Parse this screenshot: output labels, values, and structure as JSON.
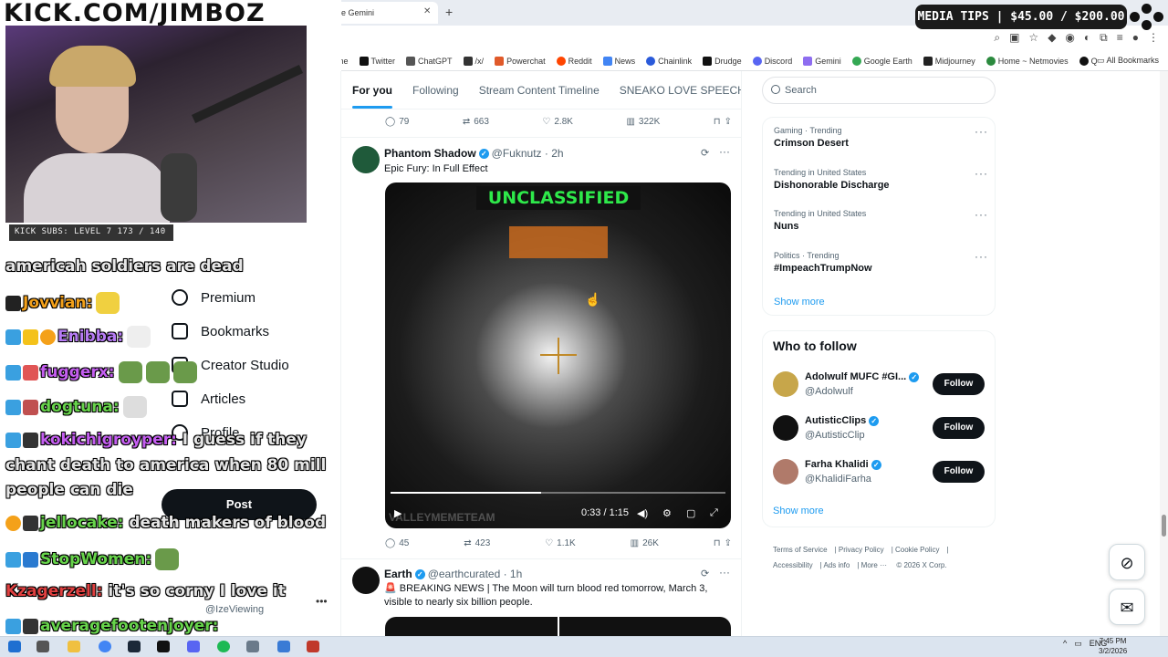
{
  "stream_overlay": {
    "banner": "KICK.COM/JIMBOZ",
    "subs_bar": "KICK SUBS: LEVEL 7 173 / 140",
    "media_tips": "MEDIA TIPS | $45.00 / $200.00",
    "chat": [
      {
        "user": "",
        "text": "americah soldiers are dead",
        "user_color": "#ffffff"
      },
      {
        "user": "Jovvian:",
        "text": "",
        "user_color": "#f4a11a"
      },
      {
        "user": "Enibba:",
        "text": "",
        "user_color": "#b77cf5"
      },
      {
        "user": "fuggerx:",
        "text": "",
        "user_color": "#c45ef0"
      },
      {
        "user": "dogtuna:",
        "text": "",
        "user_color": "#67d44b"
      },
      {
        "user": "kokichigroyper:",
        "text": "I guess if they",
        "user_color": "#c45ef0"
      },
      {
        "user": "",
        "text": "chant death to america when 80 mill",
        "user_color": "#ffffff"
      },
      {
        "user": "",
        "text": "people can die",
        "user_color": "#ffffff"
      },
      {
        "user": "jellocake:",
        "text": "death makers of blood",
        "user_color": "#67d44b"
      },
      {
        "user": "StopWomen:",
        "text": "",
        "user_color": "#67d44b"
      },
      {
        "user": "Kzagerzell:",
        "text": "it's so corny I love it",
        "user_color": "#e04040"
      },
      {
        "user": "averagefootenjoyer:",
        "text": "",
        "user_color": "#67d44b"
      }
    ]
  },
  "browser": {
    "tab_title": "Google Gemini",
    "bookmarks": [
      "Gioryp.me",
      "Twitter",
      "ChatGPT",
      "/x/",
      "Powerchat",
      "Reddit",
      "News",
      "Chainlink",
      "Drudge",
      "Discord",
      "Gemini",
      "Google Earth",
      "Midjourney",
      "Home ~ Netmovies",
      "Q"
    ],
    "all_bookmarks": "All Bookmarks"
  },
  "sidebar": {
    "items": [
      {
        "label": "Premium",
        "icon": "verified-icon"
      },
      {
        "label": "Bookmarks",
        "icon": "bookmark-icon"
      },
      {
        "label": "Creator Studio",
        "icon": "creator-studio-icon"
      },
      {
        "label": "Articles",
        "icon": "article-icon"
      },
      {
        "label": "Profile",
        "icon": "profile-icon"
      }
    ],
    "post_button": "Post",
    "account_handle": "@IzeViewing"
  },
  "feed": {
    "tabs": [
      "For you",
      "Following",
      "Stream Content Timeline",
      "SNEAKO LOVE SPEECH"
    ],
    "prev_actions": {
      "replies": "79",
      "reposts": "663",
      "likes": "2.8K",
      "views": "322K"
    },
    "tweet1": {
      "name": "Phantom Shadow",
      "handle": "@Fuknutz",
      "time": "· 2h",
      "text": "Epic Fury: In Full Effect",
      "video_label": "UNCLASSIFIED",
      "video_time": "0:33 / 1:15",
      "video_progress": 0.45,
      "watermark": "VALLEYMEMETEAM",
      "actions": {
        "replies": "45",
        "reposts": "423",
        "likes": "1.1K",
        "views": "26K"
      }
    },
    "tweet2": {
      "name": "Earth",
      "handle": "@earthcurated",
      "time": "· 1h",
      "text": "🚨 BREAKING NEWS | The Moon will turn blood red tomorrow, March 3, visible to nearly six billion people."
    }
  },
  "right": {
    "search_placeholder": "Search",
    "trends": [
      {
        "category": "Gaming · Trending",
        "name": "Crimson Desert"
      },
      {
        "category": "Trending in United States",
        "name": "Dishonorable Discharge"
      },
      {
        "category": "Trending in United States",
        "name": "Nuns"
      },
      {
        "category": "Politics · Trending",
        "name": "#ImpeachTrumpNow"
      }
    ],
    "show_more": "Show more",
    "who_to_follow": "Who to follow",
    "follow_suggestions": [
      {
        "name": "Adolwulf MUFC #GI...",
        "handle": "@Adolwulf",
        "button": "Follow"
      },
      {
        "name": "AutisticClips",
        "handle": "@AutisticClip",
        "button": "Follow"
      },
      {
        "name": "Farha Khalidi",
        "handle": "@KhalidiFarha",
        "button": "Follow"
      }
    ],
    "footer": [
      "Terms of Service",
      "Privacy Policy",
      "Cookie Policy",
      "Accessibility",
      "Ads info",
      "More ···",
      "© 2026 X Corp."
    ]
  },
  "taskbar": {
    "lang": "ENG",
    "time": "7:45 PM",
    "date": "3/2/2026"
  }
}
